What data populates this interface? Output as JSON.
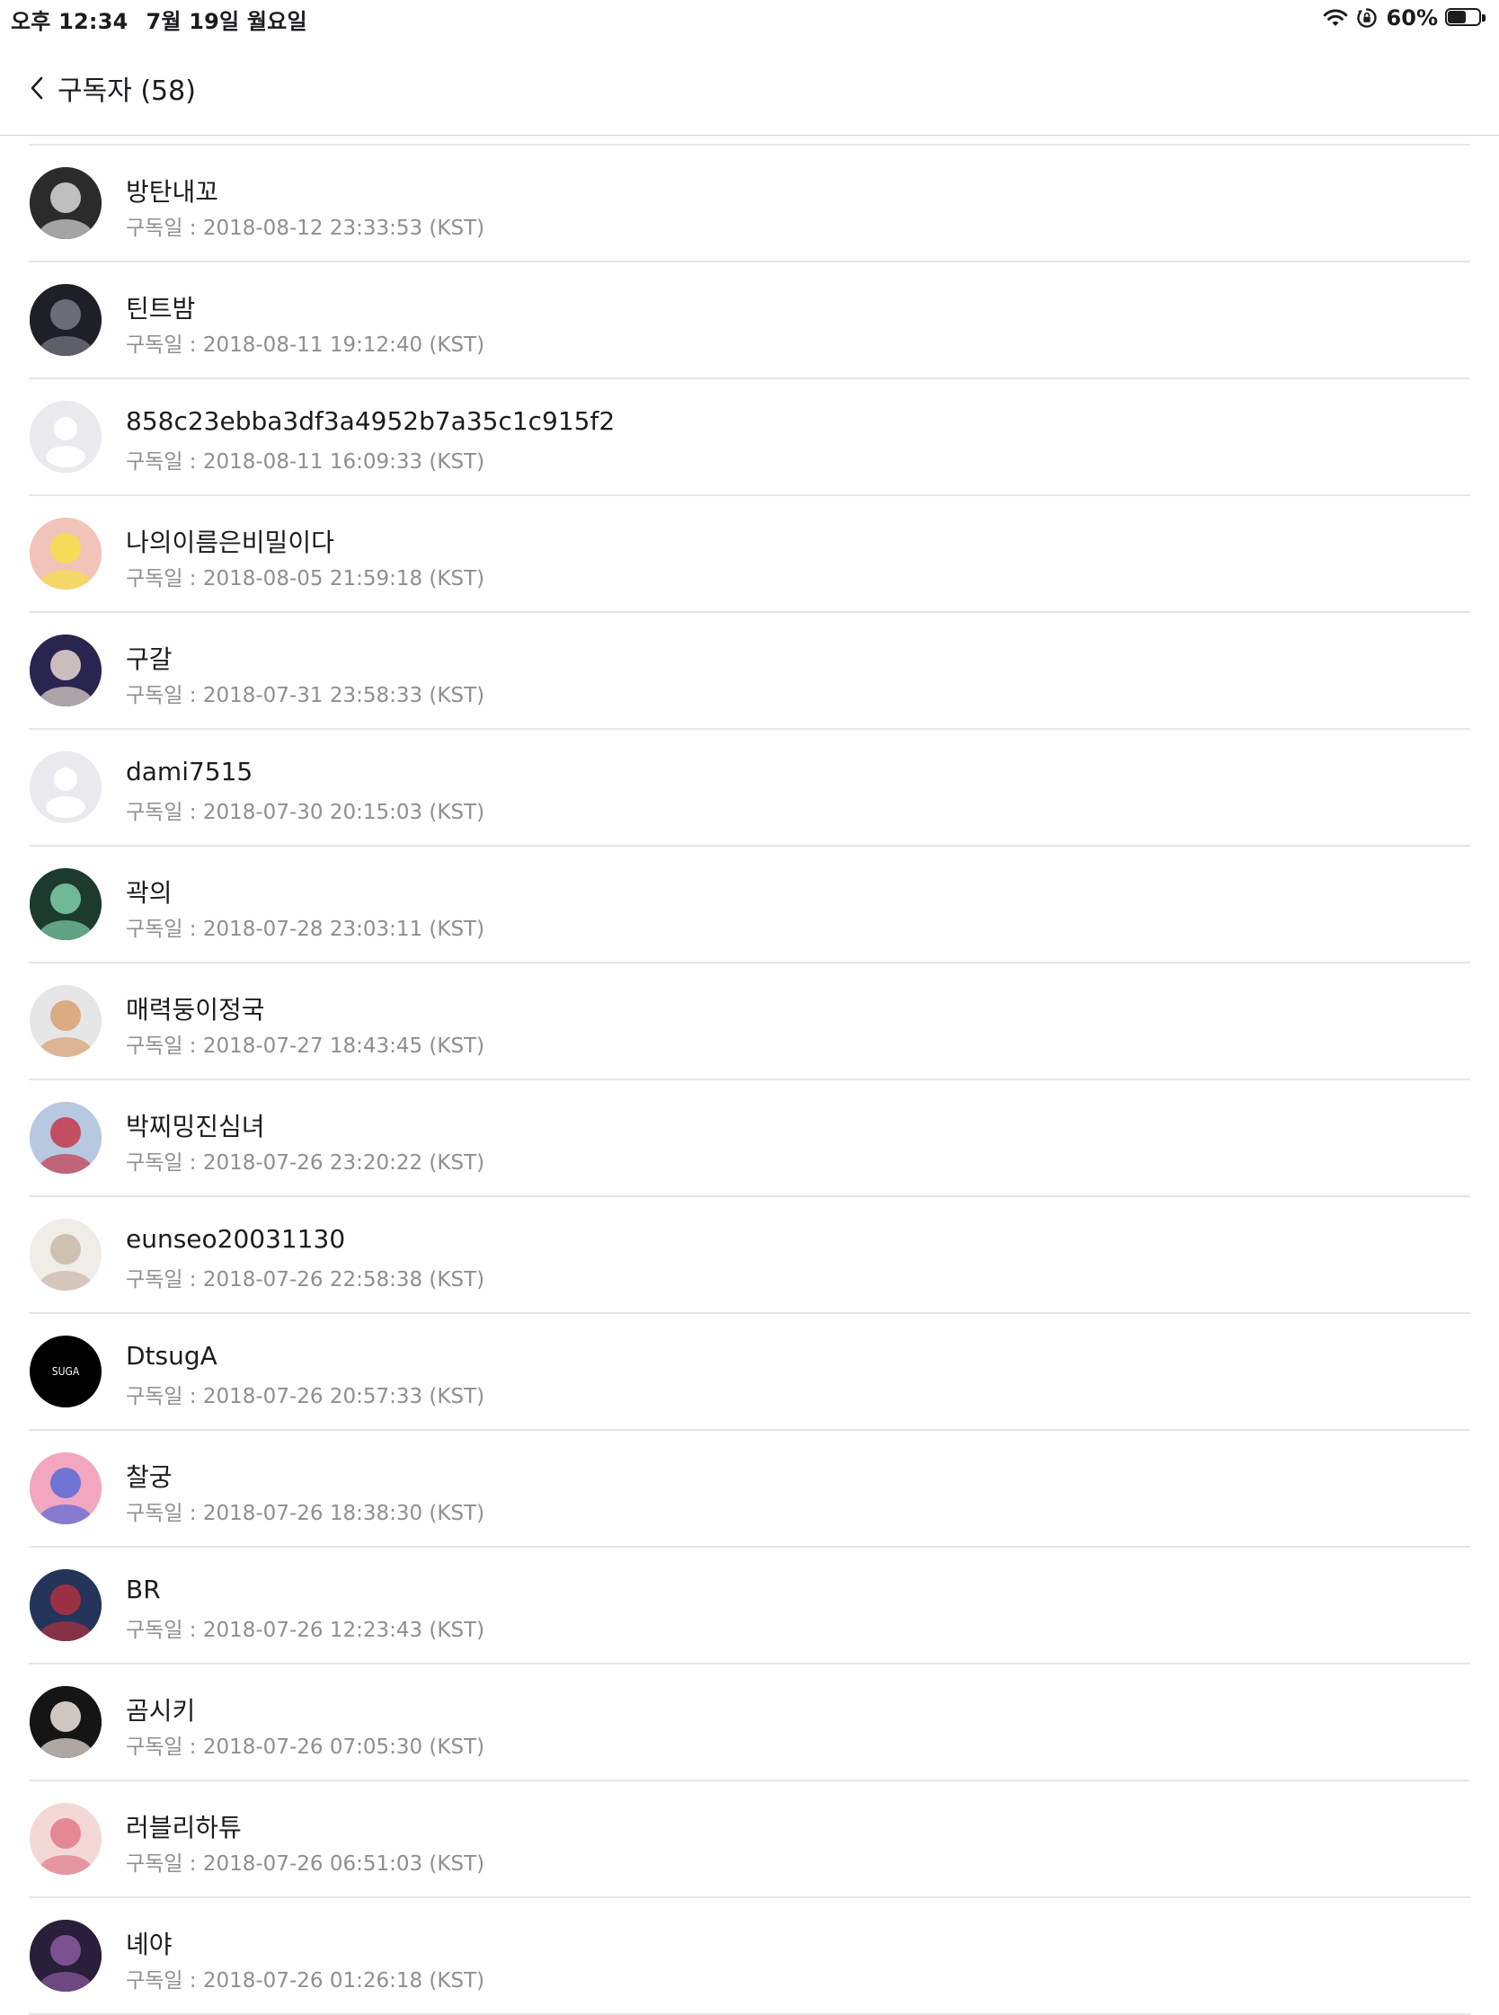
{
  "status_bar": {
    "time": "오후 12:34",
    "date": "7월 19일 월요일",
    "battery_percent_label": "60%",
    "battery_level": 0.6,
    "icons": [
      "wifi-icon",
      "orientation-lock-icon",
      "battery-icon"
    ]
  },
  "nav": {
    "back_icon": "chevron-left-icon",
    "title": "구독자 (58)"
  },
  "subscribers": [
    {
      "name": "방탄내꼬",
      "date": "구독일 : 2018-08-12 23:33:53 (KST)",
      "avatar": "photo",
      "avatar_color": "#2b2b2b",
      "avatar_color2": "#d9d9d9"
    },
    {
      "name": "틴트밤",
      "date": "구독일 : 2018-08-11 19:12:40 (KST)",
      "avatar": "photo",
      "avatar_color": "#1f1f28",
      "avatar_color2": "#7a7a85"
    },
    {
      "name": "858c23ebba3df3a4952b7a35c1c915f2",
      "date": "구독일 : 2018-08-11 16:09:33 (KST)",
      "avatar": "default",
      "avatar_color": "#e9e9ee",
      "avatar_color2": "#ffffff"
    },
    {
      "name": "나의이름은비밀이다",
      "date": "구독일 : 2018-08-05 21:59:18 (KST)",
      "avatar": "photo",
      "avatar_color": "#f2c3b8",
      "avatar_color2": "#f5e04a"
    },
    {
      "name": "구갈",
      "date": "구독일 : 2018-07-31 23:58:33 (KST)",
      "avatar": "photo",
      "avatar_color": "#2a2550",
      "avatar_color2": "#e6d9cf"
    },
    {
      "name": "dami7515",
      "date": "구독일 : 2018-07-30 20:15:03 (KST)",
      "avatar": "default",
      "avatar_color": "#e9e9ee",
      "avatar_color2": "#ffffff"
    },
    {
      "name": "곽의",
      "date": "구독일 : 2018-07-28 23:03:11 (KST)",
      "avatar": "photo",
      "avatar_color": "#1d3a2e",
      "avatar_color2": "#7fd0a8"
    },
    {
      "name": "매력둥이정국",
      "date": "구독일 : 2018-07-27 18:43:45 (KST)",
      "avatar": "photo",
      "avatar_color": "#e6e6e6",
      "avatar_color2": "#d8a070"
    },
    {
      "name": "박찌밍진심녀",
      "date": "구독일 : 2018-07-26 23:20:22 (KST)",
      "avatar": "photo",
      "avatar_color": "#b8c8e0",
      "avatar_color2": "#c23a4a"
    },
    {
      "name": "eunseo20031130",
      "date": "구독일 : 2018-07-26 22:58:38 (KST)",
      "avatar": "photo",
      "avatar_color": "#f0ece8",
      "avatar_color2": "#c9b8a8"
    },
    {
      "name": "DtsugA",
      "date": "구독일 : 2018-07-26 20:57:33 (KST)",
      "avatar": "label",
      "avatar_label": "SUGA",
      "avatar_color": "#000000",
      "avatar_color2": "#ffffff"
    },
    {
      "name": "찰궁",
      "date": "구독일 : 2018-07-26 18:38:30 (KST)",
      "avatar": "photo",
      "avatar_color": "#f2a6c0",
      "avatar_color2": "#5a6ad8"
    },
    {
      "name": "BR",
      "date": "구독일 : 2018-07-26 12:23:43 (KST)",
      "avatar": "photo",
      "avatar_color": "#25345a",
      "avatar_color2": "#b03040"
    },
    {
      "name": "곰시키",
      "date": "구독일 : 2018-07-26 07:05:30 (KST)",
      "avatar": "photo",
      "avatar_color": "#151515",
      "avatar_color2": "#f0e6e0"
    },
    {
      "name": "러블리하튜",
      "date": "구독일 : 2018-07-26 06:51:03 (KST)",
      "avatar": "photo",
      "avatar_color": "#f4d8d8",
      "avatar_color2": "#e07a8a"
    },
    {
      "name": "녜야",
      "date": "구독일 : 2018-07-26 01:26:18 (KST)",
      "avatar": "photo",
      "avatar_color": "#2a1f3a",
      "avatar_color2": "#8a5aa0"
    }
  ]
}
